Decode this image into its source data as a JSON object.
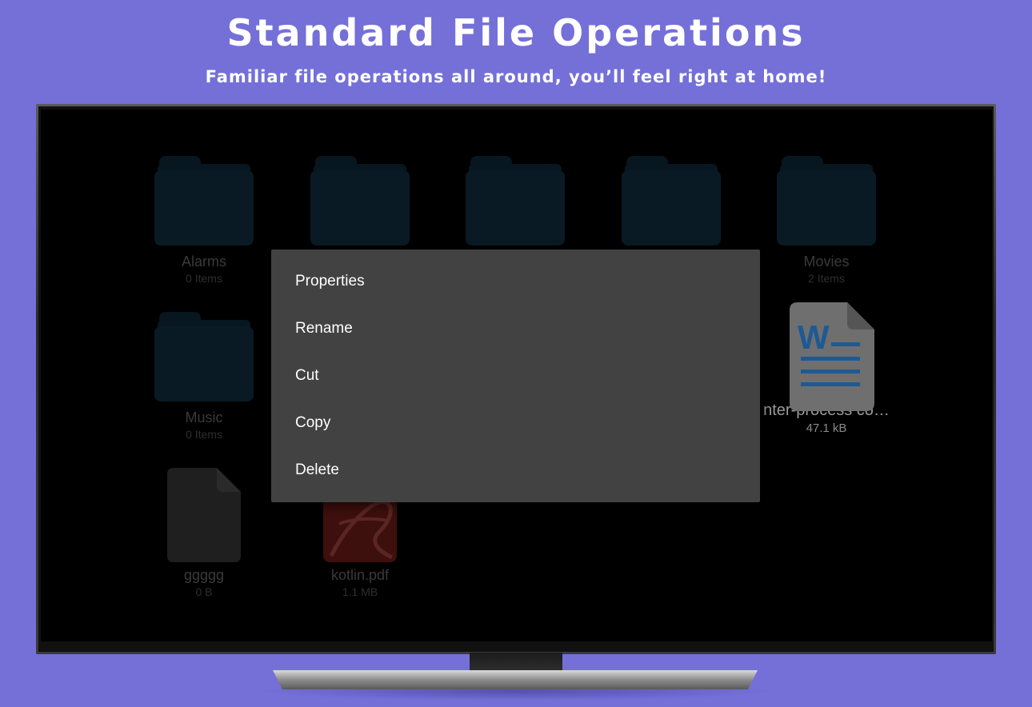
{
  "colors": {
    "background": "#7470d8",
    "menu_bg": "#424242",
    "folder": "#0a1a25",
    "word_blue": "#1d5a94",
    "pdf_red": "#3d0f0d"
  },
  "header": {
    "title": "Standard File Operations",
    "subtitle": "Familiar file operations all around, you’ll feel right at home!"
  },
  "files": [
    {
      "name": "Alarms",
      "meta": "0 Items",
      "icon": "folder-icon"
    },
    {
      "name": "",
      "meta": "",
      "icon": "folder-icon"
    },
    {
      "name": "",
      "meta": "",
      "icon": "folder-icon"
    },
    {
      "name": "",
      "meta": "",
      "icon": "folder-icon"
    },
    {
      "name": "Movies",
      "meta": "2 Items",
      "icon": "folder-icon"
    },
    {
      "name": "Music",
      "meta": "0 Items",
      "icon": "folder-icon"
    },
    {
      "name": "nter-process co…",
      "meta": "47.1 kB",
      "icon": "word-document-icon"
    },
    {
      "name": "ggggg",
      "meta": "0 B",
      "icon": "file-icon"
    },
    {
      "name": "kotlin.pdf",
      "meta": "1.1 MB",
      "icon": "pdf-icon"
    }
  ],
  "context_menu": {
    "items": [
      "Properties",
      "Rename",
      "Cut",
      "Copy",
      "Delete"
    ]
  }
}
